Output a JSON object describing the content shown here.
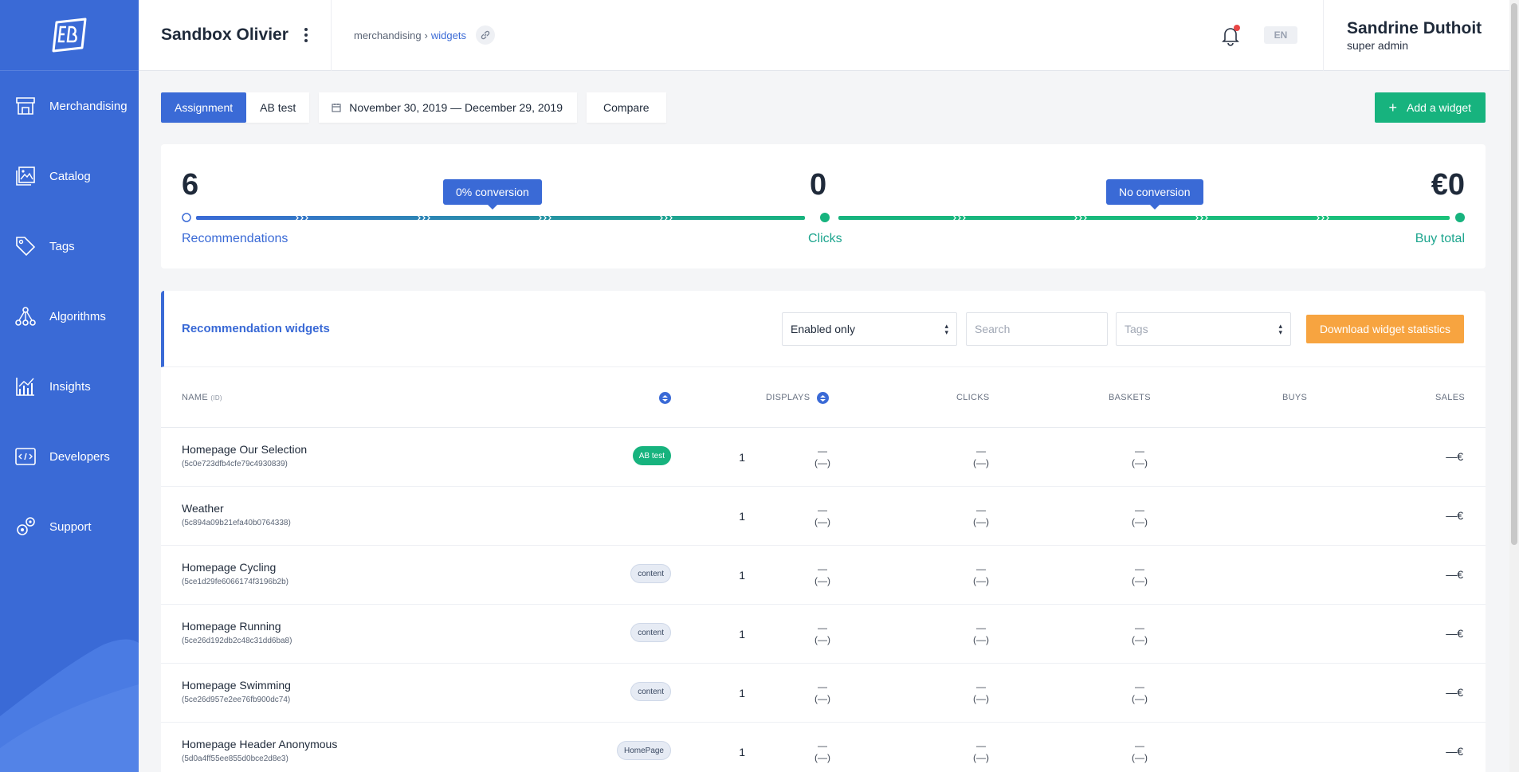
{
  "sidebar": {
    "items": [
      {
        "label": "Merchandising",
        "icon": "store-icon"
      },
      {
        "label": "Catalog",
        "icon": "catalog-icon"
      },
      {
        "label": "Tags",
        "icon": "tag-icon"
      },
      {
        "label": "Algorithms",
        "icon": "algorithm-icon"
      },
      {
        "label": "Insights",
        "icon": "insights-icon"
      },
      {
        "label": "Developers",
        "icon": "code-icon"
      },
      {
        "label": "Support",
        "icon": "support-icon"
      }
    ]
  },
  "topbar": {
    "title": "Sandbox Olivier",
    "breadcrumb": {
      "parent": "merchandising",
      "separator": "›",
      "current": "widgets"
    },
    "language": "EN",
    "user": {
      "name": "Sandrine Duthoit",
      "role": "super admin"
    }
  },
  "controls": {
    "assignment_label": "Assignment",
    "abtest_label": "AB test",
    "date_range": "November 30, 2019 — December 29, 2019",
    "compare_label": "Compare",
    "add_widget_label": "Add a widget"
  },
  "funnel": {
    "recommendations_value": "6",
    "recommendations_label": "Recommendations",
    "clicks_value": "0",
    "clicks_label": "Clicks",
    "buy_value": "€0",
    "buy_label": "Buy total",
    "conversion1": "0% conversion",
    "conversion2": "No conversion"
  },
  "widgets": {
    "title": "Recommendation widgets",
    "status_filter": "Enabled only",
    "search_placeholder": "Search",
    "tags_placeholder": "Tags",
    "download_label": "Download widget statistics",
    "columns": {
      "name": "Name",
      "name_sub": "(ID)",
      "displays": "Displays",
      "clicks": "Clicks",
      "baskets": "Baskets",
      "buys": "Buys",
      "sales": "Sales"
    },
    "rows": [
      {
        "name": "Homepage Our Selection",
        "id": "(5c0e723dfb4cfe79c4930839)",
        "tag": "AB test",
        "displays": "1",
        "clicks": "—",
        "clicks_sub": "(—)",
        "baskets": "—",
        "baskets_sub": "(—)",
        "buys": "—",
        "buys_sub": "(—)",
        "sales": "—€"
      },
      {
        "name": "Weather",
        "id": "(5c894a09b21efa40b0764338)",
        "tag": "",
        "displays": "1",
        "clicks": "—",
        "clicks_sub": "(—)",
        "baskets": "—",
        "baskets_sub": "(—)",
        "buys": "—",
        "buys_sub": "(—)",
        "sales": "—€"
      },
      {
        "name": "Homepage Cycling",
        "id": "(5ce1d29fe6066174f3196b2b)",
        "tag": "content",
        "displays": "1",
        "clicks": "—",
        "clicks_sub": "(—)",
        "baskets": "—",
        "baskets_sub": "(—)",
        "buys": "—",
        "buys_sub": "(—)",
        "sales": "—€"
      },
      {
        "name": "Homepage Running",
        "id": "(5ce26d192db2c48c31dd6ba8)",
        "tag": "content",
        "displays": "1",
        "clicks": "—",
        "clicks_sub": "(—)",
        "baskets": "—",
        "baskets_sub": "(—)",
        "buys": "—",
        "buys_sub": "(—)",
        "sales": "—€"
      },
      {
        "name": "Homepage Swimming",
        "id": "(5ce26d957e2ee76fb900dc74)",
        "tag": "content",
        "displays": "1",
        "clicks": "—",
        "clicks_sub": "(—)",
        "baskets": "—",
        "baskets_sub": "(—)",
        "buys": "—",
        "buys_sub": "(—)",
        "sales": "—€"
      },
      {
        "name": "Homepage Header Anonymous",
        "id": "(5d0a4ff55ee855d0bce2d8e3)",
        "tag": "HomePage",
        "displays": "1",
        "clicks": "—",
        "clicks_sub": "(—)",
        "baskets": "—",
        "baskets_sub": "(—)",
        "buys": "—",
        "buys_sub": "(—)",
        "sales": "—€"
      }
    ]
  },
  "colors": {
    "brand": "#3a6ad6",
    "success": "#17b37e",
    "warning": "#f7a440",
    "alert": "#e84545"
  }
}
